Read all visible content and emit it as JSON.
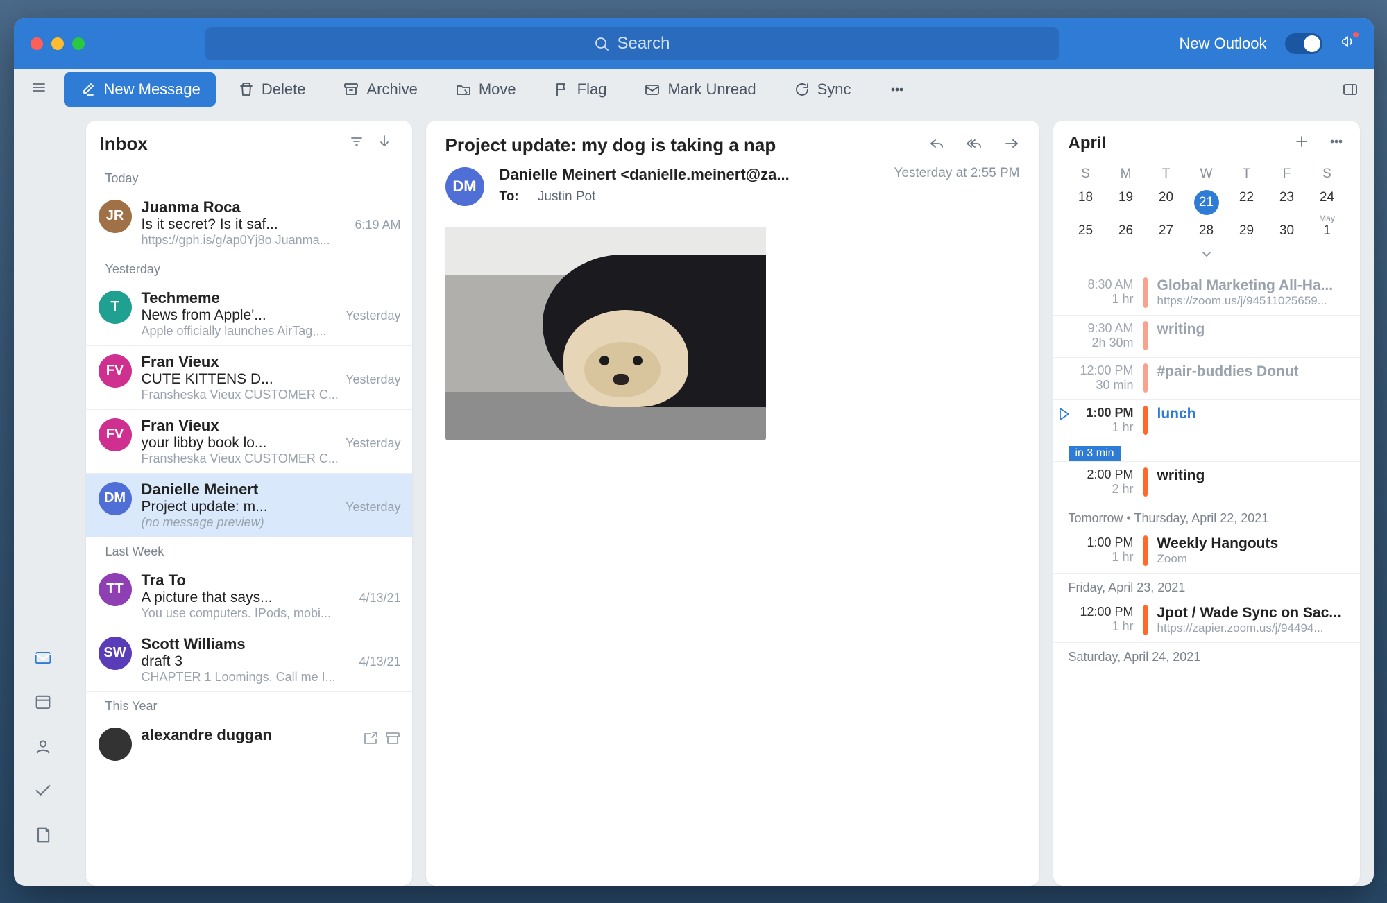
{
  "titlebar": {
    "search_placeholder": "Search",
    "new_outlook": "New Outlook"
  },
  "toolbar": {
    "new_message": "New Message",
    "delete": "Delete",
    "archive": "Archive",
    "move": "Move",
    "flag": "Flag",
    "mark_unread": "Mark Unread",
    "sync": "Sync"
  },
  "list": {
    "title": "Inbox",
    "sections": [
      {
        "label": "Today",
        "items": [
          {
            "initials": "JR",
            "avatar_color": "#a07146",
            "sender": "Juanma Roca",
            "subject": "Is it secret? Is it saf...",
            "time": "6:19 AM",
            "preview": "https://gph.is/g/ap0Yj8o Juanma..."
          }
        ]
      },
      {
        "label": "Yesterday",
        "items": [
          {
            "initials": "T",
            "avatar_color": "#1fa091",
            "sender": "Techmeme",
            "subject": "News from Apple'...",
            "time": "Yesterday",
            "preview": "Apple officially launches AirTag,..."
          },
          {
            "initials": "FV",
            "avatar_color": "#cf2f8f",
            "sender": "Fran Vieux",
            "subject": "CUTE KITTENS D...",
            "time": "Yesterday",
            "preview": "Fransheska Vieux CUSTOMER C..."
          },
          {
            "initials": "FV",
            "avatar_color": "#cf2f8f",
            "sender": "Fran Vieux",
            "subject": "your libby book lo...",
            "time": "Yesterday",
            "preview": "Fransheska Vieux CUSTOMER C..."
          },
          {
            "initials": "DM",
            "avatar_color": "#4f6fd6",
            "sender": "Danielle Meinert",
            "subject": "Project update: m...",
            "time": "Yesterday",
            "preview": "(no message preview)",
            "selected": true,
            "preview_italic": true
          }
        ]
      },
      {
        "label": "Last Week",
        "items": [
          {
            "initials": "TT",
            "avatar_color": "#8e3fb3",
            "sender": "Tra To",
            "subject": "A picture that says...",
            "time": "4/13/21",
            "preview": "You use computers. IPods, mobi..."
          },
          {
            "initials": "SW",
            "avatar_color": "#5a3bb8",
            "sender": "Scott Williams",
            "subject": "draft 3",
            "time": "4/13/21",
            "preview": "CHAPTER 1 Loomings. Call me I..."
          }
        ]
      },
      {
        "label": "This Year",
        "items": [
          {
            "initials": "",
            "avatar_color": "#333",
            "sender": "alexandre duggan",
            "subject": "",
            "time": "",
            "preview": "",
            "icons": true
          }
        ]
      }
    ]
  },
  "reader": {
    "subject": "Project update: my dog is taking a nap",
    "from": "Danielle Meinert <danielle.meinert@za...",
    "from_initials": "DM",
    "from_color": "#4f6fd6",
    "to_label": "To:",
    "to": "Justin Pot",
    "date": "Yesterday at 2:55 PM"
  },
  "agenda": {
    "month": "April",
    "dow": [
      "S",
      "M",
      "T",
      "W",
      "T",
      "F",
      "S"
    ],
    "weeks": [
      [
        "18",
        "19",
        "20",
        "21",
        "22",
        "23",
        "24"
      ],
      [
        "25",
        "26",
        "27",
        "28",
        "29",
        "30",
        "1"
      ]
    ],
    "today": "21",
    "may_label": "May",
    "now_badge": "in 3 min",
    "events_today": [
      {
        "t1": "8:30 AM",
        "t2": "1 hr",
        "title": "Global Marketing All-Ha...",
        "sub": "https://zoom.us/j/94511025659...",
        "color": "#f9a38d",
        "dim": true
      },
      {
        "t1": "9:30 AM",
        "t2": "2h 30m",
        "title": "writing",
        "sub": "",
        "color": "#f9a38d",
        "dim": true
      },
      {
        "t1": "12:00 PM",
        "t2": "30 min",
        "title": "#pair-buddies Donut",
        "sub": "",
        "color": "#f9a38d",
        "dim": true
      },
      {
        "t1": "1:00 PM",
        "t2": "1 hr",
        "title": "lunch",
        "sub": "",
        "color": "#ff6a2b",
        "current": true
      },
      {
        "t1": "2:00 PM",
        "t2": "2 hr",
        "title": "writing",
        "sub": "",
        "color": "#ff6a2b"
      }
    ],
    "groups": [
      {
        "label": "Tomorrow  •  Thursday, April 22, 2021",
        "events": [
          {
            "t1": "1:00 PM",
            "t2": "1 hr",
            "title": "Weekly Hangouts",
            "sub": "Zoom",
            "color": "#ff6a2b"
          }
        ]
      },
      {
        "label": "Friday, April 23, 2021",
        "events": [
          {
            "t1": "12:00 PM",
            "t2": "1 hr",
            "title": "Jpot / Wade Sync on Sac...",
            "sub": "https://zapier.zoom.us/j/94494...",
            "color": "#ff6a2b"
          }
        ]
      },
      {
        "label": "Saturday, April 24, 2021",
        "events": []
      }
    ]
  }
}
